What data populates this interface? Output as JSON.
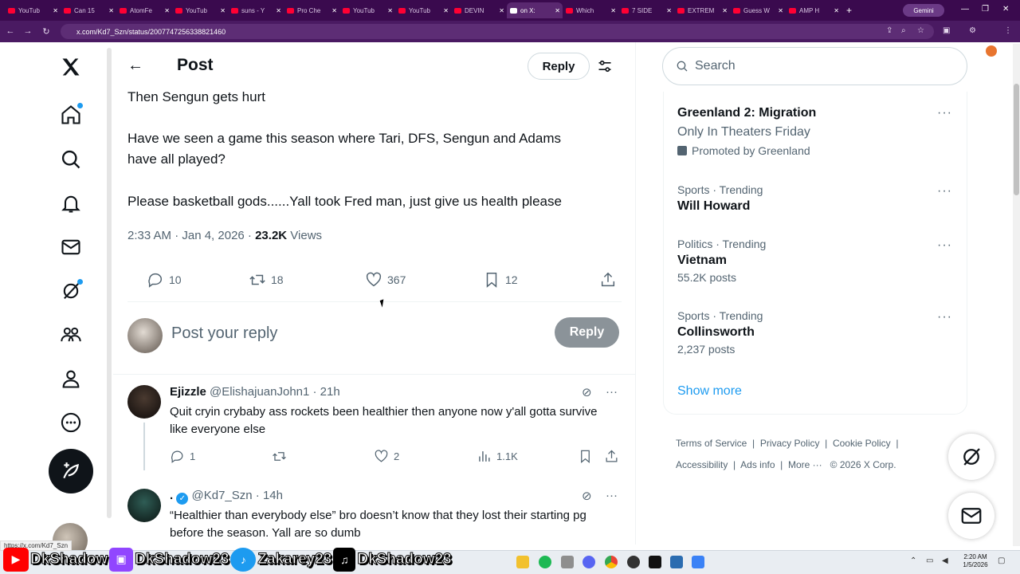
{
  "browser": {
    "tabs": [
      {
        "label": "YouTub",
        "fav": "yt"
      },
      {
        "label": "Can 15",
        "fav": "yt"
      },
      {
        "label": "AtomFe",
        "fav": "yt"
      },
      {
        "label": "YouTub",
        "fav": "yt"
      },
      {
        "label": "suns - Y",
        "fav": "yt"
      },
      {
        "label": "Pro Che",
        "fav": "yt"
      },
      {
        "label": "YouTub",
        "fav": "yt"
      },
      {
        "label": "YouTub",
        "fav": "yt"
      },
      {
        "label": "DEVIN",
        "fav": "yt"
      },
      {
        "label": "on X:",
        "fav": "x",
        "active": true
      },
      {
        "label": "Which",
        "fav": "yt"
      },
      {
        "label": "7 SIDE",
        "fav": "yt"
      },
      {
        "label": "EXTREM",
        "fav": "yt"
      },
      {
        "label": "Guess W",
        "fav": "yt"
      },
      {
        "label": "AMP H",
        "fav": "yt"
      }
    ],
    "new_tab": "+",
    "gemini_label": "Gemini",
    "url": "x.com/Kd7_Szn/status/2007747256338821460",
    "status_url": "https://x.com/Kd7_Szn"
  },
  "post": {
    "header_title": "Post",
    "header_reply": "Reply",
    "lines": [
      "Then Sengun gets hurt",
      "Have we seen a game this season where Tari, DFS, Sengun and Adams",
      "have all played?",
      "Please basketball gods......Yall took Fred man, just give us health please"
    ],
    "timestamp": "2:33 AM · Jan 4, 2026 · ",
    "views_count": "23.2K",
    "views_label": " Views",
    "actions": {
      "replies": "10",
      "reposts": "18",
      "likes": "367",
      "bookmarks": "12"
    },
    "reply_placeholder": "Post your reply",
    "reply_button": "Reply"
  },
  "replies": [
    {
      "name": "Ejizzle",
      "handle": "@ElishajuanJohn1 · 21h",
      "text": "Quit cryin crybaby ass rockets been healthier then anyone now y'all gotta survive like everyone else",
      "replies": "1",
      "reposts": "",
      "likes": "2",
      "views": "1.1K"
    },
    {
      "name": ".",
      "handle": "@Kd7_Szn · 14h",
      "text": "“Healthier than everybody else” bro doesn’t know that they lost their starting pg before the season. Yall are so dumb"
    }
  ],
  "sidebar": {
    "search_placeholder": "Search",
    "trends": [
      {
        "line1": "",
        "title": "Greenland 2: Migration",
        "sub": "Only In Theaters Friday",
        "promo": "Promoted by Greenland"
      },
      {
        "line1": "Sports · Trending",
        "title": "Will Howard",
        "sub": ""
      },
      {
        "line1": "Politics · Trending",
        "title": "Vietnam",
        "sub": "55.2K posts"
      },
      {
        "line1": "Sports · Trending",
        "title": "Collinsworth",
        "sub": "2,237 posts"
      }
    ],
    "show_more": "Show more",
    "footer": {
      "terms": "Terms of Service",
      "privacy": "Privacy Policy",
      "cookie": "Cookie Policy",
      "accessibility": "Accessibility",
      "ads": "Ads info",
      "more": "More ···",
      "copyright": "© 2026 X Corp."
    }
  },
  "overlay": {
    "yt": "DkShadow",
    "twitch": "DkShadow23",
    "twitter": "Zakarey23",
    "tiktok": "DkShadow23"
  },
  "clock": {
    "time": "2:20 AM",
    "date": "1/5/2026"
  },
  "colors": {
    "accent": "#1d9bf0",
    "text": "#0f1419",
    "muted": "#536471",
    "browser_bg": "#3a0a4e"
  }
}
